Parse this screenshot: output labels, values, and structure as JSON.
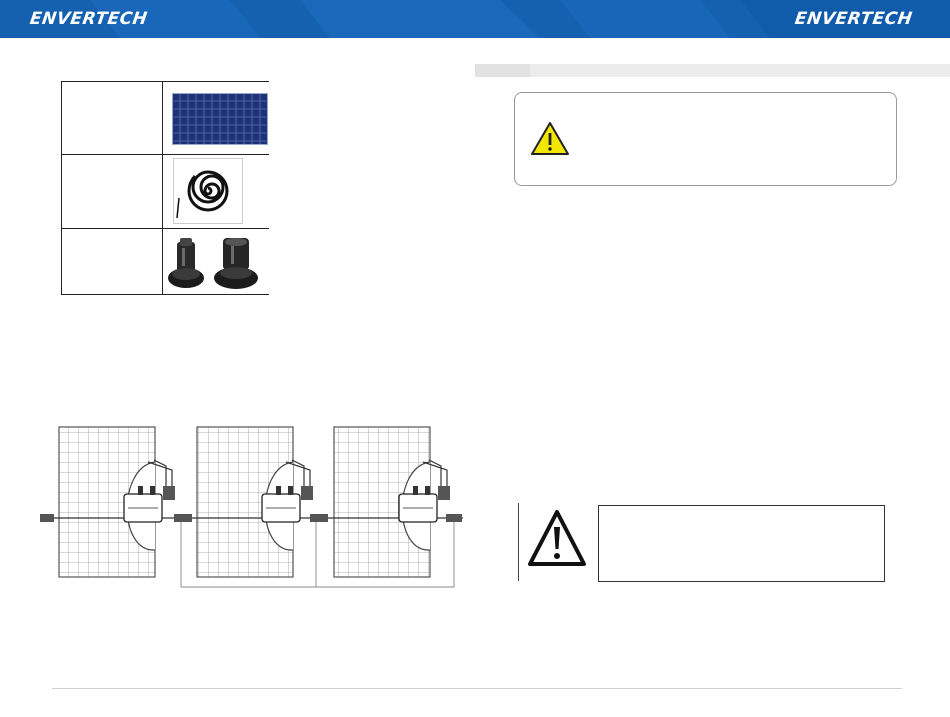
{
  "header": {
    "brand_left": "ENVERTECH",
    "brand_right": "ENVERTECH",
    "background_color": "#1561b0"
  },
  "parts_table": {
    "rows": [
      {
        "icon": "solar-panel-icon"
      },
      {
        "icon": "coiled-cable-icon"
      },
      {
        "icon": "connector-icon"
      }
    ]
  },
  "warning_notice": {
    "icon": "warning-triangle-icon",
    "icon_color": "#f3e600"
  },
  "caution_notice": {
    "icon": "warning-triangle-icon"
  },
  "installation_diagram": {
    "panels": 3,
    "microinverters": 3
  }
}
